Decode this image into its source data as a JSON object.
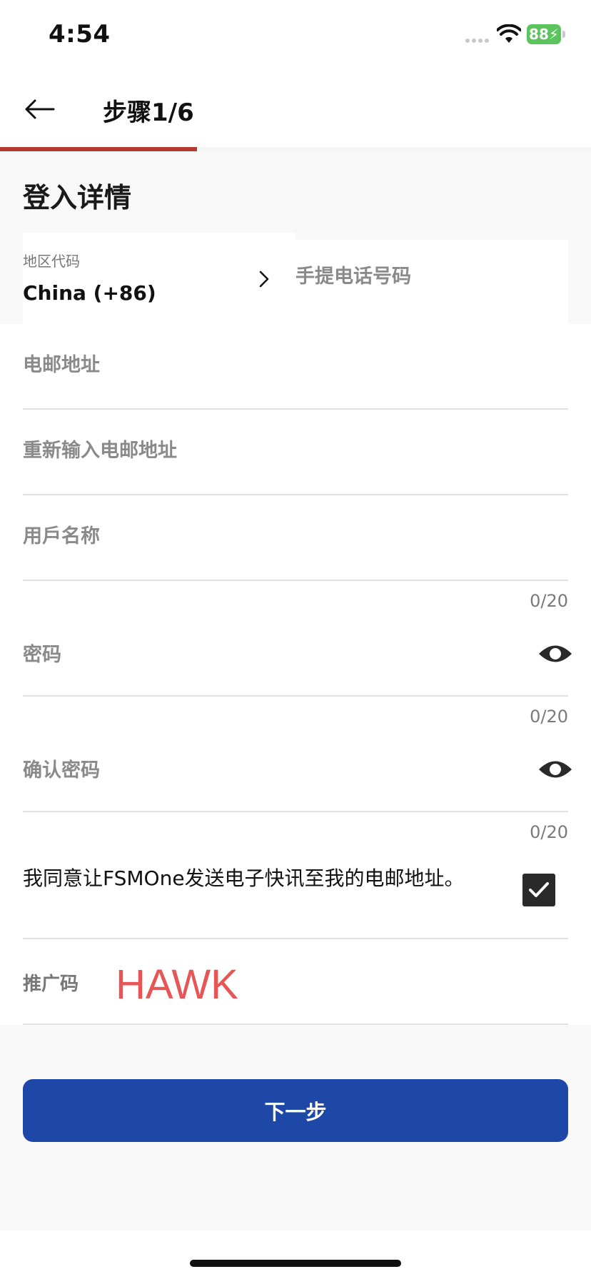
{
  "status_bar": {
    "time": "4:54",
    "battery_level": "88"
  },
  "nav": {
    "title": "步骤1/6",
    "progress_fraction": 0.333
  },
  "section": {
    "heading": "登入详情"
  },
  "region": {
    "label": "地区代码",
    "value": "China (+86)"
  },
  "phone": {
    "placeholder": "手提电话号码"
  },
  "email": {
    "placeholder": "电邮地址"
  },
  "email_confirm": {
    "placeholder": "重新输入电邮地址"
  },
  "username": {
    "placeholder": "用戶名称",
    "counter": "0/20"
  },
  "password": {
    "placeholder": "密码",
    "counter": "0/20"
  },
  "password_confirm": {
    "placeholder": "确认密码",
    "counter": "0/20"
  },
  "consent": {
    "text": "我同意让FSMOne发送电子快讯至我的电邮地址。",
    "checked": true
  },
  "promo": {
    "label": "推广码",
    "value": "HAWK"
  },
  "next_button": {
    "label": "下一步"
  },
  "colors": {
    "progress_accent": "#b63a32",
    "primary_button": "#1e48a8",
    "promo_text": "#e85555",
    "battery_green": "#5cc45c"
  }
}
